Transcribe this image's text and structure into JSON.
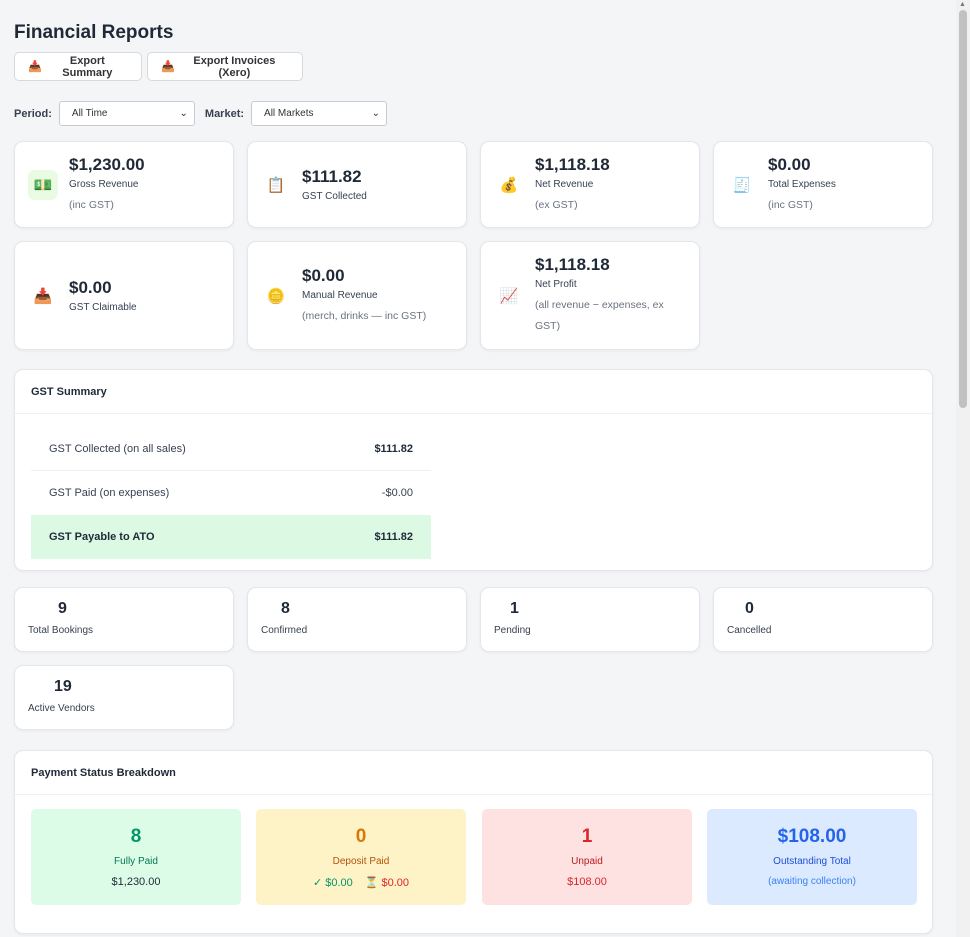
{
  "header": {
    "title": "Financial Reports",
    "export_summary_label": "Export Summary",
    "export_invoices_label": "Export Invoices (Xero)"
  },
  "filters": {
    "period_label": "Period:",
    "period_value": "All Time",
    "market_label": "Market:",
    "market_value": "All Markets"
  },
  "stats": [
    {
      "icon": "cash-icon",
      "glyph": "💵",
      "value": "$1,230.00",
      "label": "Gross Revenue",
      "sub": "(inc GST)"
    },
    {
      "icon": "clipboard-icon",
      "glyph": "📋",
      "value": "$111.82",
      "label": "GST Collected",
      "sub": ""
    },
    {
      "icon": "money-bag-icon",
      "glyph": "💰",
      "value": "$1,118.18",
      "label": "Net Revenue",
      "sub": "(ex GST)"
    },
    {
      "icon": "receipt-icon",
      "glyph": "🧾",
      "value": "$0.00",
      "label": "Total Expenses",
      "sub": "(inc GST)"
    },
    {
      "icon": "inbox-icon",
      "glyph": "📥",
      "value": "$0.00",
      "label": "GST Claimable",
      "sub": ""
    },
    {
      "icon": "coin-icon",
      "glyph": "🪙",
      "value": "$0.00",
      "label": "Manual Revenue",
      "sub": "(merch, drinks — inc GST)"
    },
    {
      "icon": "chart-up-icon",
      "glyph": "📈",
      "value": "$1,118.18",
      "label": "Net Profit",
      "sub": "(all revenue − expenses, ex GST)"
    }
  ],
  "gst_summary": {
    "title": "GST Summary",
    "rows": [
      {
        "label": "GST Collected (on all sales)",
        "amount": "$111.82"
      },
      {
        "label": "GST Paid (on expenses)",
        "amount": "-$0.00"
      },
      {
        "label": "GST Payable to ATO",
        "amount": "$111.82"
      }
    ]
  },
  "counts": [
    {
      "value": "9",
      "label": "Total Bookings"
    },
    {
      "value": "8",
      "label": "Confirmed"
    },
    {
      "value": "1",
      "label": "Pending"
    },
    {
      "value": "0",
      "label": "Cancelled"
    },
    {
      "value": "19",
      "label": "Active Vendors"
    }
  ],
  "payment_breakdown": {
    "title": "Payment Status Breakdown",
    "fully_paid": {
      "count": "8",
      "label": "Fully Paid",
      "amount": "$1,230.00"
    },
    "deposit_paid": {
      "count": "0",
      "label": "Deposit Paid",
      "paid": "✓ $0.00",
      "pending": "⏳ $0.00"
    },
    "unpaid": {
      "count": "1",
      "label": "Unpaid",
      "amount": "$108.00"
    },
    "outstanding": {
      "amount": "$108.00",
      "label": "Outstanding Total",
      "note": "(awaiting collection)"
    }
  },
  "colors": {
    "fully_paid_bg": "#dcfce7",
    "fully_paid_fg": "#059669",
    "deposit_bg": "#fef3c7",
    "deposit_fg": "#d97706",
    "unpaid_bg": "#fee2e2",
    "unpaid_fg": "#dc2626",
    "outstanding_bg": "#dbeafe",
    "outstanding_fg": "#2563eb"
  }
}
